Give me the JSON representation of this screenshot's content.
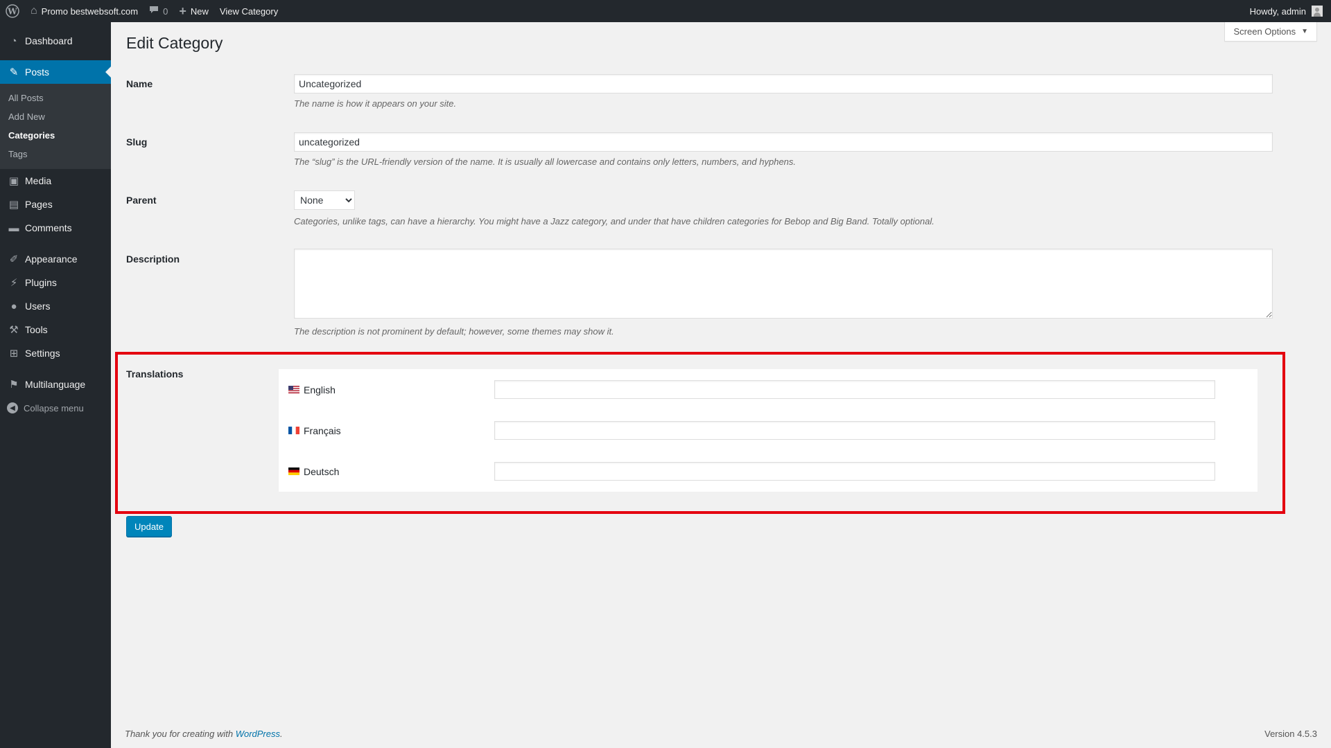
{
  "adminbar": {
    "site_name": "Promo bestwebsoft.com",
    "comments_count": "0",
    "new_label": "New",
    "view_label": "View Category",
    "howdy": "Howdy, admin"
  },
  "sidebar": {
    "items": [
      {
        "label": "Dashboard"
      },
      {
        "label": "Posts"
      },
      {
        "label": "Media"
      },
      {
        "label": "Pages"
      },
      {
        "label": "Comments"
      },
      {
        "label": "Appearance"
      },
      {
        "label": "Plugins"
      },
      {
        "label": "Users"
      },
      {
        "label": "Tools"
      },
      {
        "label": "Settings"
      },
      {
        "label": "Multilanguage"
      }
    ],
    "posts_sub": [
      "All Posts",
      "Add New",
      "Categories",
      "Tags"
    ],
    "collapse_label": "Collapse menu"
  },
  "screen_options": "Screen Options",
  "page_title": "Edit Category",
  "form": {
    "name_label": "Name",
    "name_value": "Uncategorized",
    "name_desc": "The name is how it appears on your site.",
    "slug_label": "Slug",
    "slug_value": "uncategorized",
    "slug_desc": "The “slug” is the URL-friendly version of the name. It is usually all lowercase and contains only letters, numbers, and hyphens.",
    "parent_label": "Parent",
    "parent_value": "None",
    "parent_desc": "Categories, unlike tags, can have a hierarchy. You might have a Jazz category, and under that have children categories for Bebop and Big Band. Totally optional.",
    "description_label": "Description",
    "description_desc": "The description is not prominent by default; however, some themes may show it.",
    "translations_label": "Translations",
    "languages": [
      {
        "label": "English",
        "value": ""
      },
      {
        "label": "Français",
        "value": ""
      },
      {
        "label": "Deutsch",
        "value": ""
      }
    ],
    "update_label": "Update"
  },
  "footer": {
    "thanks_prefix": "Thank you for creating with ",
    "wp_link": "WordPress",
    "thanks_suffix": ".",
    "version": "Version 4.5.3"
  },
  "colors": {
    "adminbar_bg": "#23282d",
    "accent": "#0073aa",
    "highlight": "#e4000f"
  }
}
